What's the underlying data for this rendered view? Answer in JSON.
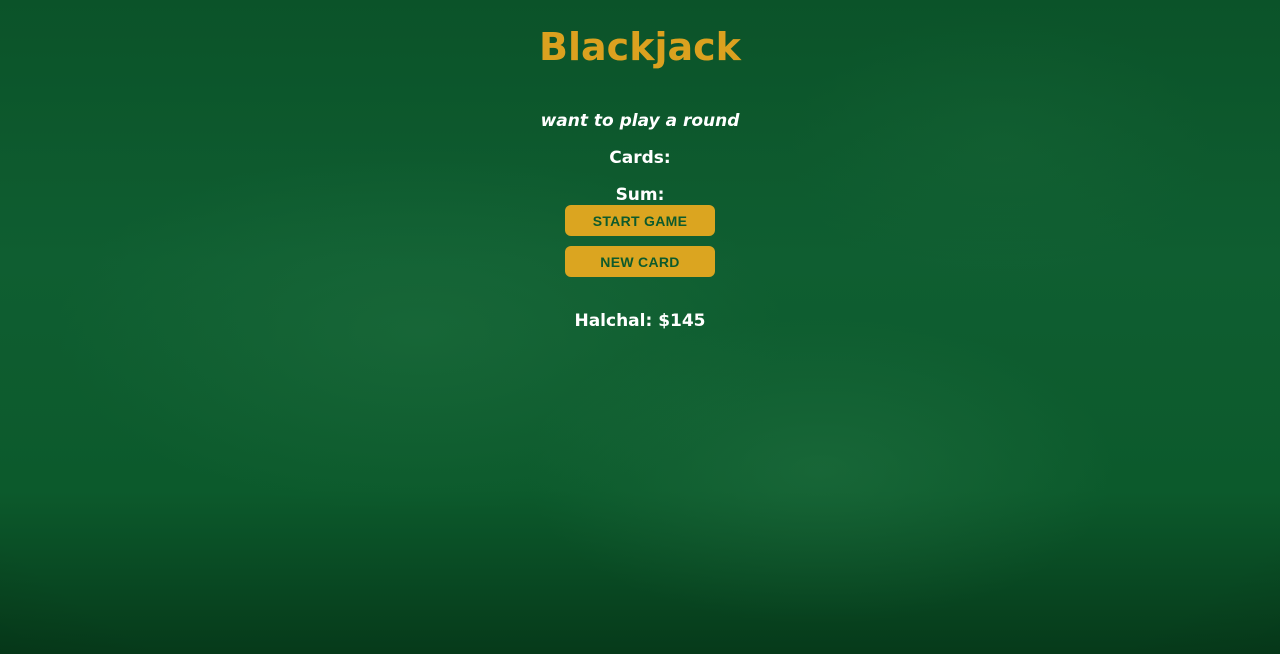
{
  "title": "Blackjack",
  "message": "want to play a round",
  "cards_label": "Cards:",
  "sum_label": "Sum:",
  "buttons": {
    "start_game": "START GAME",
    "new_card": "NEW CARD"
  },
  "player": "Halchal: $145",
  "colors": {
    "table_green": "#0d5a2c",
    "accent_gold": "#dba520",
    "text": "#ffffff"
  }
}
